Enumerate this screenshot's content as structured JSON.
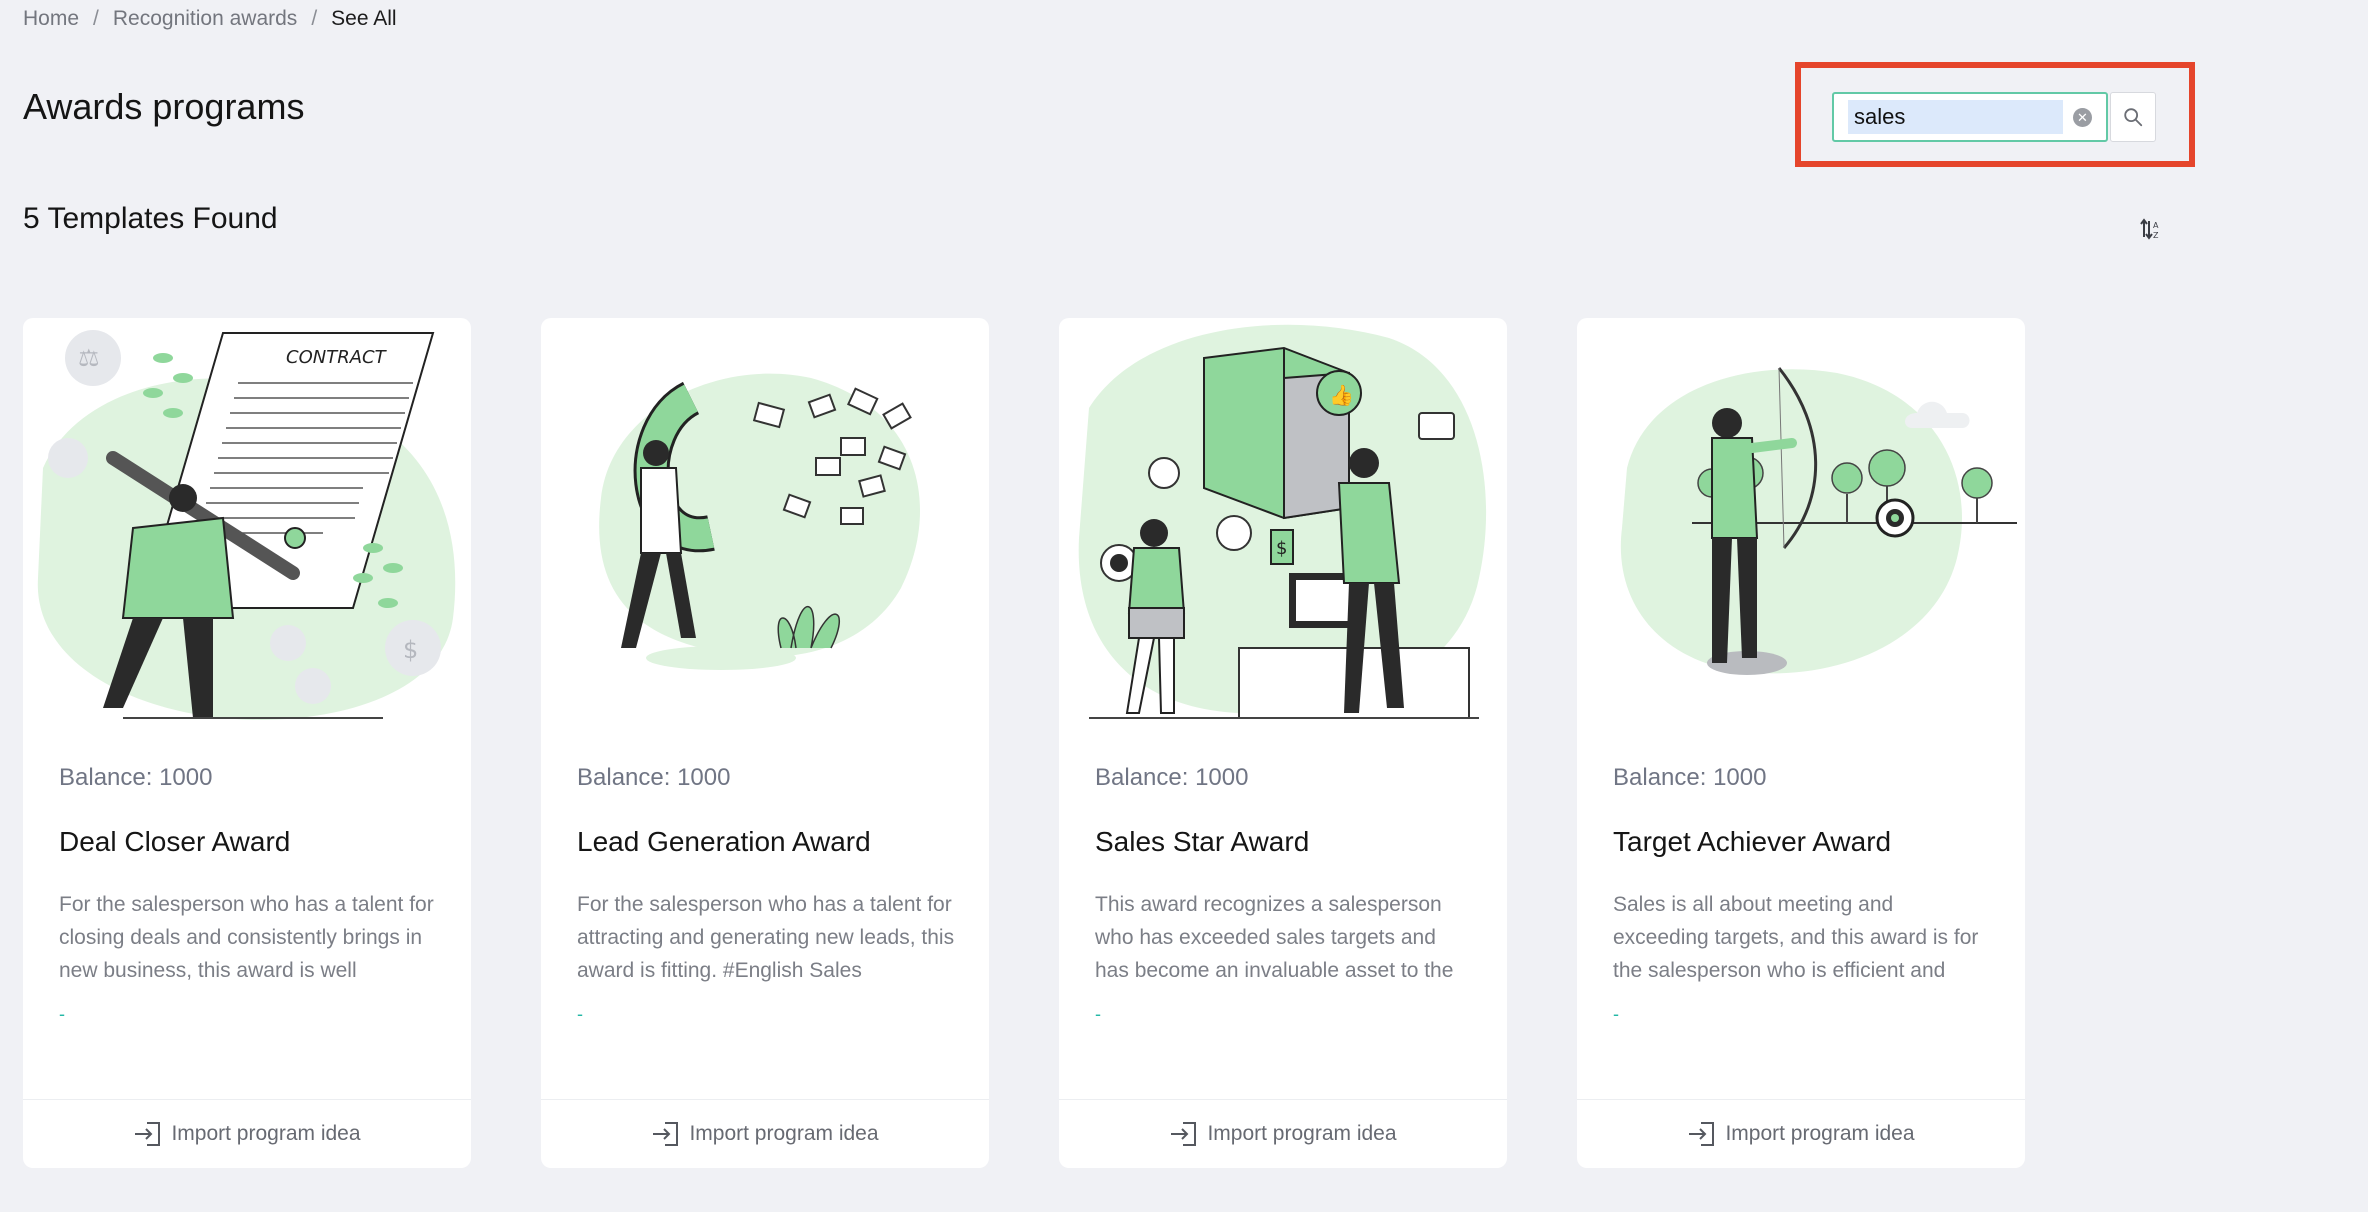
{
  "breadcrumb": {
    "home": "Home",
    "parent": "Recognition awards",
    "current": "See All",
    "separator": "/"
  },
  "page": {
    "title": "Awards programs",
    "count_label": "5 Templates Found"
  },
  "search": {
    "value": "sales",
    "clear_icon": "clear-circle-icon",
    "button_icon": "search-icon"
  },
  "sort": {
    "icon": "sort-icon"
  },
  "colors": {
    "accent": "#24b8a6",
    "illustration_green": "#8fd79b",
    "illustration_light": "#dff3df",
    "highlight": "#e5452b"
  },
  "cards": [
    {
      "balance": "Balance: 1000",
      "title": "Deal Closer Award",
      "description": "For the salesperson who has a talent for closing deals and consistently brings in new business, this award is well",
      "tag": "-",
      "action": "Import program idea",
      "action_icon": "import-icon"
    },
    {
      "balance": "Balance: 1000",
      "title": "Lead Generation Award",
      "description": "For the salesperson who has a talent for attracting and generating new leads, this award is fitting. #English Sales",
      "tag": "-",
      "action": "Import program idea",
      "action_icon": "import-icon"
    },
    {
      "balance": "Balance: 1000",
      "title": "Sales Star Award",
      "description": "This award recognizes a salesperson who has exceeded sales targets and has become an invaluable asset to the",
      "tag": "-",
      "action": "Import program idea",
      "action_icon": "import-icon"
    },
    {
      "balance": "Balance: 1000",
      "title": "Target Achiever Award",
      "description": "Sales is all about meeting and exceeding targets, and this award is for the salesperson who is efficient and",
      "tag": "-",
      "action": "Import program idea",
      "action_icon": "import-icon"
    }
  ]
}
